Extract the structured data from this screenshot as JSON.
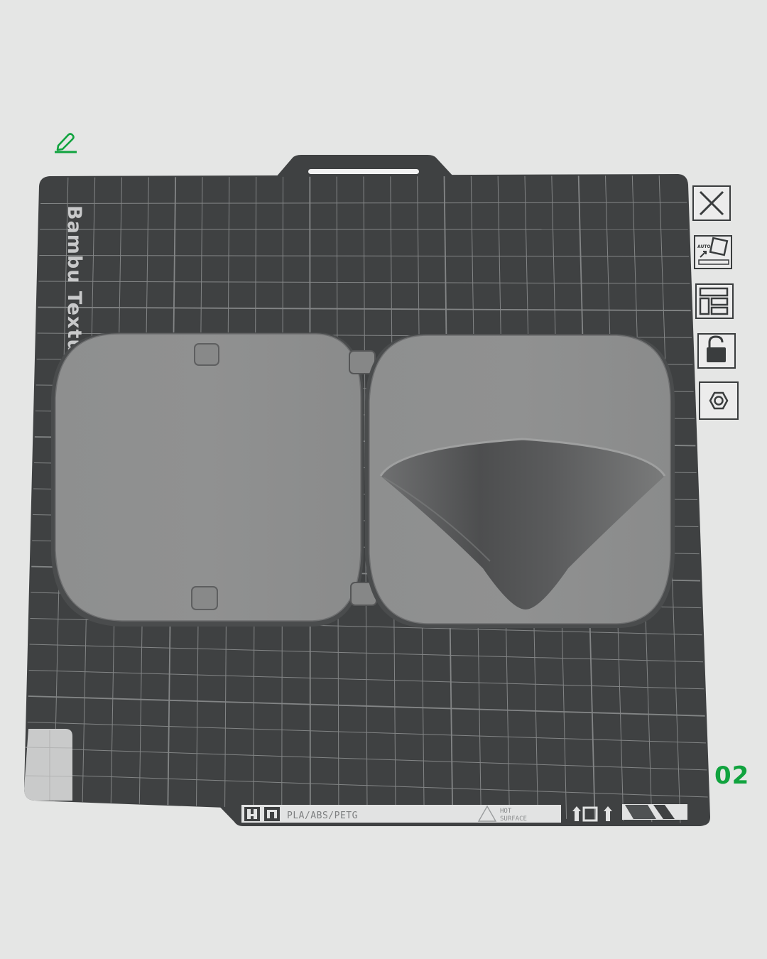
{
  "plate": {
    "number": "02",
    "brand_text": "Bambu Textured",
    "label_material": "PLA/ABS/PETG",
    "label_warning_line1": "HOT",
    "label_warning_line2": "SURFACE"
  },
  "toolbar": {
    "items": [
      {
        "name": "close-plate",
        "icon": "close-icon"
      },
      {
        "name": "auto-orient",
        "icon": "auto-orient-icon",
        "icon_text": "AUTO"
      },
      {
        "name": "arrange",
        "icon": "arrange-icon"
      },
      {
        "name": "lock-plate",
        "icon": "unlock-icon"
      },
      {
        "name": "plate-settings",
        "icon": "settings-hex-icon"
      }
    ]
  },
  "edit": {
    "icon": "pencil-icon"
  },
  "colors": {
    "background": "#e5e6e5",
    "plate": "#3f4142",
    "grid": "#9a9c9d",
    "model": "#8d8e8e",
    "accent_green": "#10a33e"
  }
}
